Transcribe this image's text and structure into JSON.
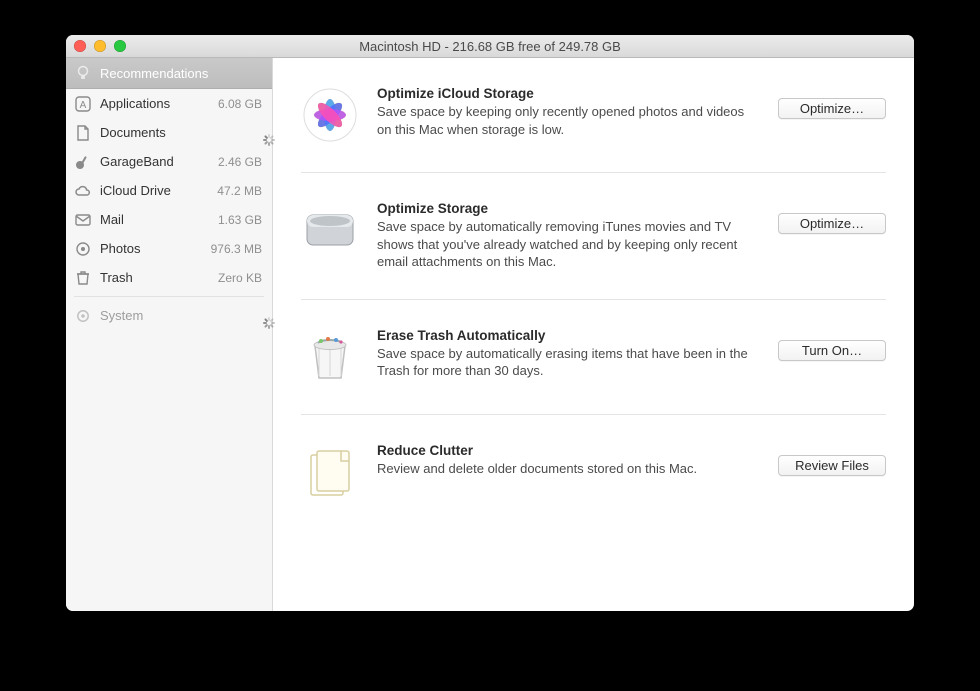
{
  "window": {
    "title": "Macintosh HD - 216.68 GB free of 249.78 GB"
  },
  "sidebar": {
    "header": "Recommendations",
    "items": [
      {
        "icon": "apps",
        "label": "Applications",
        "value": "6.08 GB",
        "loading": false
      },
      {
        "icon": "doc",
        "label": "Documents",
        "value": "",
        "loading": true
      },
      {
        "icon": "guitar",
        "label": "GarageBand",
        "value": "2.46 GB",
        "loading": false
      },
      {
        "icon": "cloud",
        "label": "iCloud Drive",
        "value": "47.2 MB",
        "loading": false
      },
      {
        "icon": "mail",
        "label": "Mail",
        "value": "1.63 GB",
        "loading": false
      },
      {
        "icon": "photos",
        "label": "Photos",
        "value": "976.3 MB",
        "loading": false
      },
      {
        "icon": "trash",
        "label": "Trash",
        "value": "Zero KB",
        "loading": false
      }
    ],
    "system": {
      "icon": "gear",
      "label": "System",
      "loading": true
    }
  },
  "sections": [
    {
      "id": "icloud",
      "icon": "photos-app",
      "title": "Optimize iCloud Storage",
      "desc": "Save space by keeping only recently opened photos and videos on this Mac when storage is low.",
      "button": "Optimize…"
    },
    {
      "id": "optimize-storage",
      "icon": "hdd",
      "title": "Optimize Storage",
      "desc": "Save space by automatically removing iTunes movies and TV shows that you've already watched and by keeping only recent email attachments on this Mac.",
      "button": "Optimize…"
    },
    {
      "id": "trash-auto",
      "icon": "trash-big",
      "title": "Erase Trash Automatically",
      "desc": "Save space by automatically erasing items that have been in the Trash for more than 30 days.",
      "button": "Turn On…"
    },
    {
      "id": "clutter",
      "icon": "folder-docs",
      "title": "Reduce Clutter",
      "desc": "Review and delete older documents stored on this Mac.",
      "button": "Review Files"
    }
  ]
}
